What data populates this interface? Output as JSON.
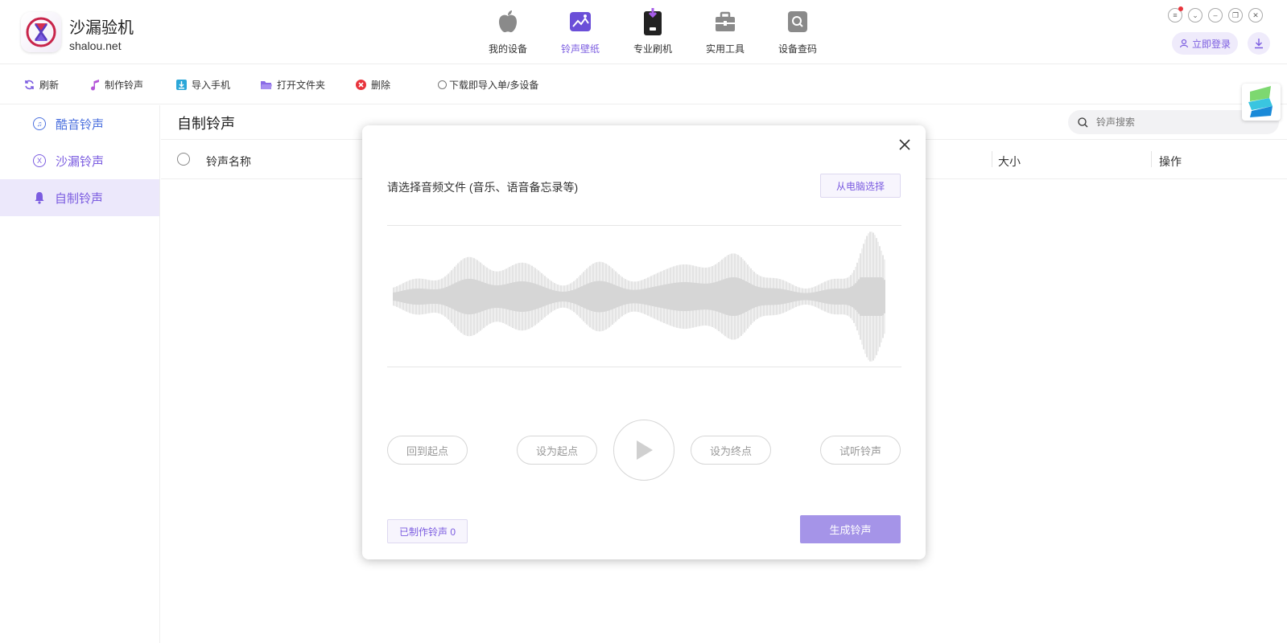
{
  "app": {
    "name": "沙漏验机",
    "site": "shalou.net"
  },
  "nav": [
    {
      "label": "我的设备",
      "icon": "apple-icon"
    },
    {
      "label": "铃声壁纸",
      "icon": "wallpaper-icon"
    },
    {
      "label": "专业刷机",
      "icon": "phone-flash-icon"
    },
    {
      "label": "实用工具",
      "icon": "toolbox-icon"
    },
    {
      "label": "设备查码",
      "icon": "search-doc-icon"
    }
  ],
  "header": {
    "login_label": "立即登录"
  },
  "toolbar": {
    "refresh": "刷新",
    "make": "制作铃声",
    "import": "导入手机",
    "open_folder": "打开文件夹",
    "delete": "删除",
    "download_import": "下载即导入单/多设备"
  },
  "sidebar": {
    "items": [
      {
        "label": "酷音铃声"
      },
      {
        "label": "沙漏铃声"
      },
      {
        "label": "自制铃声"
      }
    ]
  },
  "main": {
    "title": "自制铃声",
    "search_placeholder": "铃声搜索",
    "columns": {
      "name": "铃声名称",
      "size": "大小",
      "action": "操作"
    }
  },
  "modal": {
    "prompt": "请选择音频文件 (音乐、语音备忘录等)",
    "pick_label": "从电脑选择",
    "back_to_start": "回到起点",
    "set_start": "设为起点",
    "set_end": "设为终点",
    "preview": "试听铃声",
    "made_count": "已制作铃声 0",
    "generate": "生成铃声"
  },
  "colors": {
    "accent": "#7b5ce0",
    "accent_light": "#ece8fb",
    "primary_button": "#a594e8"
  }
}
